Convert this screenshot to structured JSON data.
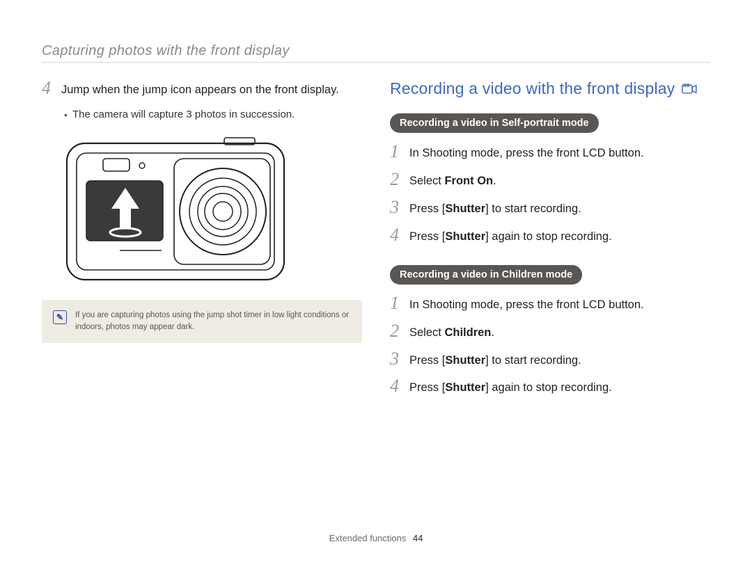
{
  "header": "Capturing photos with the front display",
  "left": {
    "step4": {
      "num": "4",
      "text": "Jump when the jump icon appears on the front display."
    },
    "bullet": "The camera will capture 3 photos in succession.",
    "note": "If you are capturing photos using the jump shot timer in low light conditions or indoors, photos may appear dark."
  },
  "right": {
    "title": "Recording a video with the front display",
    "pill1": "Recording a video in Self-portrait mode",
    "steps1": {
      "s1": {
        "num": "1",
        "text": "In Shooting mode, press the front LCD button."
      },
      "s2": {
        "num": "2",
        "pre": "Select ",
        "bold": "Front On",
        "post": "."
      },
      "s3": {
        "num": "3",
        "pre": "Press [",
        "bold": "Shutter",
        "post": "] to start recording."
      },
      "s4": {
        "num": "4",
        "pre": "Press [",
        "bold": "Shutter",
        "post": "] again to stop recording."
      }
    },
    "pill2": "Recording a video in Children mode",
    "steps2": {
      "s1": {
        "num": "1",
        "text": "In Shooting mode, press the front LCD button."
      },
      "s2": {
        "num": "2",
        "pre": "Select ",
        "bold": "Children",
        "post": "."
      },
      "s3": {
        "num": "3",
        "pre": "Press [",
        "bold": "Shutter",
        "post": "] to start recording."
      },
      "s4": {
        "num": "4",
        "pre": "Press [",
        "bold": "Shutter",
        "post": "] again to stop recording."
      }
    }
  },
  "footer": {
    "label": "Extended functions",
    "page": "44"
  }
}
